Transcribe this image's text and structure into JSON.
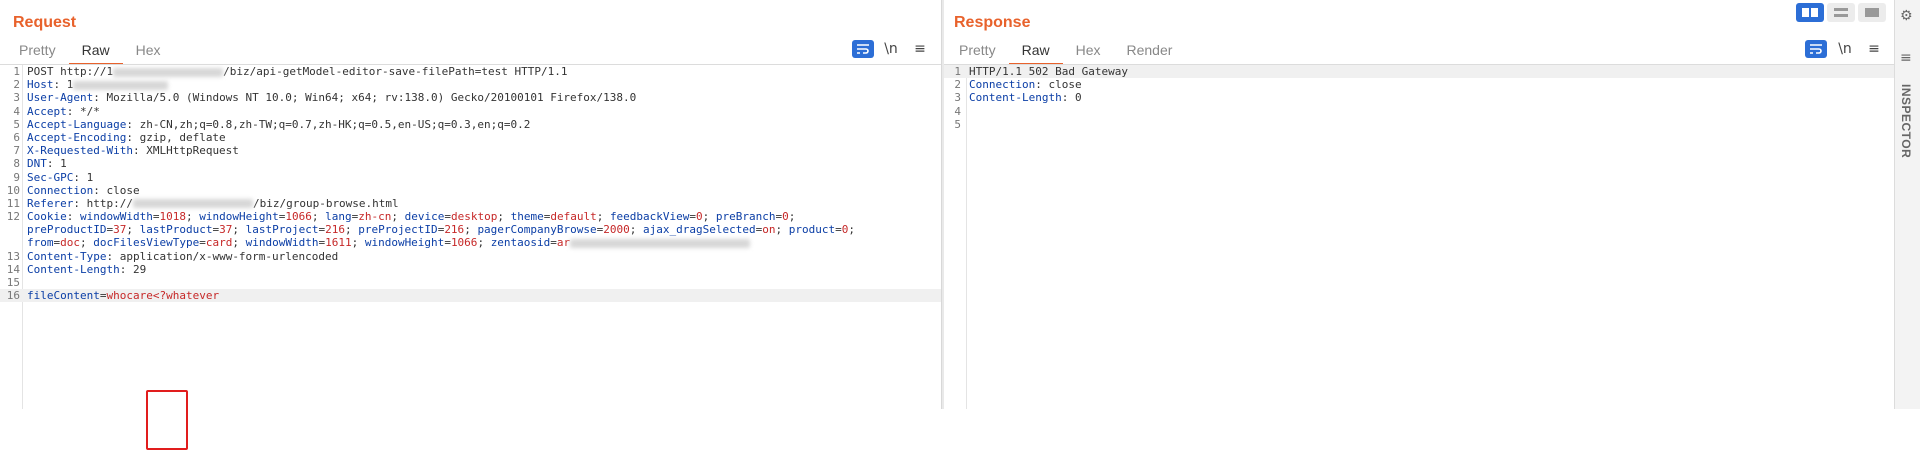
{
  "request": {
    "title": "Request",
    "tabs": [
      "Pretty",
      "Raw",
      "Hex"
    ],
    "active_tab": "Raw",
    "tools": {
      "wrap_icon": "wrap-lines-icon",
      "newline_label": "\\n",
      "menu_label": "≡"
    },
    "lines": [
      {
        "n": "1",
        "parts": [
          {
            "t": "POST http://1",
            "c": "val"
          },
          {
            "blur": 110
          },
          {
            "t": "/biz/api-getModel-editor-save-filePath=test HTTP/1.1",
            "c": "val"
          }
        ]
      },
      {
        "n": "2",
        "parts": [
          {
            "t": "Host",
            "c": "hdr"
          },
          {
            "t": ": 1",
            "c": "val"
          },
          {
            "blur": 95
          }
        ]
      },
      {
        "n": "3",
        "parts": [
          {
            "t": "User-Agent",
            "c": "hdr"
          },
          {
            "t": ": Mozilla/5.0 (Windows NT 10.0; Win64; x64; rv:138.0) Gecko/20100101 Firefox/138.0",
            "c": "val"
          }
        ]
      },
      {
        "n": "4",
        "parts": [
          {
            "t": "Accept",
            "c": "hdr"
          },
          {
            "t": ": */*",
            "c": "val"
          }
        ]
      },
      {
        "n": "5",
        "parts": [
          {
            "t": "Accept-Language",
            "c": "hdr"
          },
          {
            "t": ": zh-CN,zh;q=0.8,zh-TW;q=0.7,zh-HK;q=0.5,en-US;q=0.3,en;q=0.2",
            "c": "val"
          }
        ]
      },
      {
        "n": "6",
        "parts": [
          {
            "t": "Accept-Encoding",
            "c": "hdr"
          },
          {
            "t": ": gzip, deflate",
            "c": "val"
          }
        ]
      },
      {
        "n": "7",
        "parts": [
          {
            "t": "X-Requested-With",
            "c": "hdr"
          },
          {
            "t": ": XMLHttpRequest",
            "c": "val"
          }
        ]
      },
      {
        "n": "8",
        "parts": [
          {
            "t": "DNT",
            "c": "hdr"
          },
          {
            "t": ": 1",
            "c": "val"
          }
        ]
      },
      {
        "n": "9",
        "parts": [
          {
            "t": "Sec-GPC",
            "c": "hdr"
          },
          {
            "t": ": 1",
            "c": "val"
          }
        ]
      },
      {
        "n": "10",
        "parts": [
          {
            "t": "Connection",
            "c": "hdr"
          },
          {
            "t": ": close",
            "c": "val"
          }
        ]
      },
      {
        "n": "11",
        "parts": [
          {
            "t": "Referer",
            "c": "hdr"
          },
          {
            "t": ": http://",
            "c": "val"
          },
          {
            "blur": 120
          },
          {
            "t": "/biz/group-browse.html",
            "c": "val"
          }
        ]
      },
      {
        "n": "12",
        "parts": [
          {
            "t": "Cookie",
            "c": "hdr"
          },
          {
            "t": ": ",
            "c": "val"
          },
          {
            "t": "windowWidth",
            "c": "ck"
          },
          {
            "t": "=",
            "c": "val"
          },
          {
            "t": "1018",
            "c": "cv"
          },
          {
            "t": "; ",
            "c": "val"
          },
          {
            "t": "windowHeight",
            "c": "ck"
          },
          {
            "t": "=",
            "c": "val"
          },
          {
            "t": "1066",
            "c": "cv"
          },
          {
            "t": "; ",
            "c": "val"
          },
          {
            "t": "lang",
            "c": "ck"
          },
          {
            "t": "=",
            "c": "val"
          },
          {
            "t": "zh-cn",
            "c": "cv"
          },
          {
            "t": "; ",
            "c": "val"
          },
          {
            "t": "device",
            "c": "ck"
          },
          {
            "t": "=",
            "c": "val"
          },
          {
            "t": "desktop",
            "c": "cv"
          },
          {
            "t": "; ",
            "c": "val"
          },
          {
            "t": "theme",
            "c": "ck"
          },
          {
            "t": "=",
            "c": "val"
          },
          {
            "t": "default",
            "c": "cv"
          },
          {
            "t": "; ",
            "c": "val"
          },
          {
            "t": "feedbackView",
            "c": "ck"
          },
          {
            "t": "=",
            "c": "val"
          },
          {
            "t": "0",
            "c": "cv"
          },
          {
            "t": "; ",
            "c": "val"
          },
          {
            "t": "preBranch",
            "c": "ck"
          },
          {
            "t": "=",
            "c": "val"
          },
          {
            "t": "0",
            "c": "cv"
          },
          {
            "t": ";",
            "c": "val"
          }
        ]
      },
      {
        "n": "",
        "parts": [
          {
            "t": "preProductID",
            "c": "ck"
          },
          {
            "t": "=",
            "c": "val"
          },
          {
            "t": "37",
            "c": "cv"
          },
          {
            "t": "; ",
            "c": "val"
          },
          {
            "t": "lastProduct",
            "c": "ck"
          },
          {
            "t": "=",
            "c": "val"
          },
          {
            "t": "37",
            "c": "cv"
          },
          {
            "t": "; ",
            "c": "val"
          },
          {
            "t": "lastProject",
            "c": "ck"
          },
          {
            "t": "=",
            "c": "val"
          },
          {
            "t": "216",
            "c": "cv"
          },
          {
            "t": "; ",
            "c": "val"
          },
          {
            "t": "preProjectID",
            "c": "ck"
          },
          {
            "t": "=",
            "c": "val"
          },
          {
            "t": "216",
            "c": "cv"
          },
          {
            "t": "; ",
            "c": "val"
          },
          {
            "t": "pagerCompanyBrowse",
            "c": "ck"
          },
          {
            "t": "=",
            "c": "val"
          },
          {
            "t": "2000",
            "c": "cv"
          },
          {
            "t": "; ",
            "c": "val"
          },
          {
            "t": "ajax_dragSelected",
            "c": "ck"
          },
          {
            "t": "=",
            "c": "val"
          },
          {
            "t": "on",
            "c": "cv"
          },
          {
            "t": "; ",
            "c": "val"
          },
          {
            "t": "product",
            "c": "ck"
          },
          {
            "t": "=",
            "c": "val"
          },
          {
            "t": "0",
            "c": "cv"
          },
          {
            "t": ";",
            "c": "val"
          }
        ]
      },
      {
        "n": "",
        "parts": [
          {
            "t": "from",
            "c": "ck"
          },
          {
            "t": "=",
            "c": "val"
          },
          {
            "t": "doc",
            "c": "cv"
          },
          {
            "t": "; ",
            "c": "val"
          },
          {
            "t": "docFilesViewType",
            "c": "ck"
          },
          {
            "t": "=",
            "c": "val"
          },
          {
            "t": "card",
            "c": "cv"
          },
          {
            "t": "; ",
            "c": "val"
          },
          {
            "t": "windowWidth",
            "c": "ck"
          },
          {
            "t": "=",
            "c": "val"
          },
          {
            "t": "1611",
            "c": "cv"
          },
          {
            "t": "; ",
            "c": "val"
          },
          {
            "t": "windowHeight",
            "c": "ck"
          },
          {
            "t": "=",
            "c": "val"
          },
          {
            "t": "1066",
            "c": "cv"
          },
          {
            "t": "; ",
            "c": "val"
          },
          {
            "t": "zentaosid",
            "c": "ck"
          },
          {
            "t": "=",
            "c": "val"
          },
          {
            "t": "ar",
            "c": "cv"
          },
          {
            "blur": 180
          }
        ]
      },
      {
        "n": "13",
        "parts": [
          {
            "t": "Content-Type",
            "c": "hdr"
          },
          {
            "t": ": application/x-www-form-urlencoded",
            "c": "val"
          }
        ]
      },
      {
        "n": "14",
        "parts": [
          {
            "t": "Content-Length",
            "c": "hdr"
          },
          {
            "t": ": 29",
            "c": "val"
          }
        ]
      },
      {
        "n": "15",
        "parts": []
      },
      {
        "n": "16",
        "hl": true,
        "parts": [
          {
            "t": "fileContent",
            "c": "ck"
          },
          {
            "t": "=",
            "c": "val"
          },
          {
            "t": "whocare<?whatever",
            "c": "cv"
          }
        ]
      }
    ]
  },
  "response": {
    "title": "Response",
    "tabs": [
      "Pretty",
      "Raw",
      "Hex",
      "Render"
    ],
    "active_tab": "Raw",
    "tools": {
      "wrap_icon": "wrap-lines-icon",
      "newline_label": "\\n",
      "menu_label": "≡"
    },
    "lines": [
      {
        "n": "1",
        "hl": true,
        "parts": [
          {
            "t": "HTTP/1.1 502 Bad Gateway",
            "c": "val"
          }
        ]
      },
      {
        "n": "2",
        "parts": [
          {
            "t": "Connection",
            "c": "hdr"
          },
          {
            "t": ": close",
            "c": "val"
          }
        ]
      },
      {
        "n": "3",
        "parts": [
          {
            "t": "Content-Length",
            "c": "hdr"
          },
          {
            "t": ": 0",
            "c": "val"
          }
        ]
      },
      {
        "n": "4",
        "parts": []
      },
      {
        "n": "5",
        "parts": []
      }
    ]
  },
  "inspector": {
    "label": "INSPECTOR",
    "gear_icon": "gear-icon",
    "menu_icon": "menu-icon"
  },
  "layout_buttons": [
    {
      "name": "split-horizontal-layout",
      "active": true
    },
    {
      "name": "split-vertical-layout",
      "active": false
    },
    {
      "name": "single-pane-layout",
      "active": false
    }
  ],
  "colors": {
    "accent": "#e8622c",
    "button": "#2c6ed6",
    "header_name": "#0b3ea6",
    "cookie_value": "#c62828",
    "highlight_box": "#e11d1d"
  }
}
